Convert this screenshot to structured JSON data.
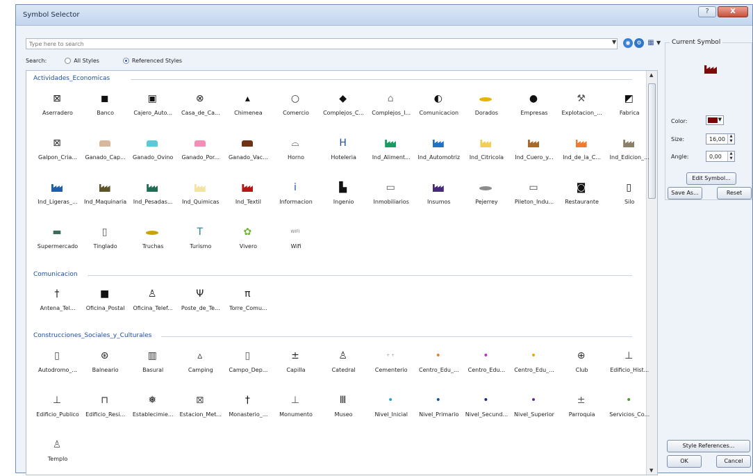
{
  "window": {
    "title": "Symbol Selector",
    "help_label": "?",
    "close_label": "X"
  },
  "search": {
    "placeholder": "Type here to search",
    "label": "Search:",
    "scopes": [
      {
        "label": "All Styles",
        "selected": false
      },
      {
        "label": "Referenced Styles",
        "selected": true
      }
    ]
  },
  "categories": [
    {
      "name": "Actividades_Economicas",
      "symbols": [
        {
          "label": "Aserradero",
          "icon": "sawmill-icon",
          "glyph": "⊠",
          "color": "#222222"
        },
        {
          "label": "Banco",
          "icon": "bank-icon",
          "glyph": "◼",
          "color": "#111111"
        },
        {
          "label": "Cajero_Auto...",
          "icon": "atm-icon",
          "glyph": "▣",
          "color": "#111111"
        },
        {
          "label": "Casa_de_Ca...",
          "icon": "exchange-icon",
          "glyph": "⊗",
          "color": "#222222"
        },
        {
          "label": "Chimenea",
          "icon": "chimney-icon",
          "glyph": "▴",
          "color": "#111111"
        },
        {
          "label": "Comercio",
          "icon": "commerce-icon",
          "glyph": "○",
          "color": "#333333"
        },
        {
          "label": "Complejos_C...",
          "icon": "complex-icon",
          "glyph": "◆",
          "color": "#111111"
        },
        {
          "label": "Complejos_I...",
          "icon": "industrial-complex-icon",
          "glyph": "⌂",
          "color": "#888888"
        },
        {
          "label": "Comunicacion",
          "icon": "communication-icon",
          "glyph": "◐",
          "color": "#111111"
        },
        {
          "label": "Dorados",
          "icon": "fish-icon",
          "glyph": "fish",
          "color": "#e7b400"
        },
        {
          "label": "Empresas",
          "icon": "company-icon",
          "glyph": "●",
          "color": "#111111"
        },
        {
          "label": "Explotacion_...",
          "icon": "mining-icon",
          "glyph": "⚒",
          "color": "#555555"
        },
        {
          "label": "Fabrica",
          "icon": "factory-icon",
          "glyph": "◩",
          "color": "#111111"
        },
        {
          "label": "Galpon_Cria...",
          "icon": "barn-icon",
          "glyph": "⊠",
          "color": "#333333"
        },
        {
          "label": "Ganado_Cap...",
          "icon": "goat-icon",
          "glyph": "animal",
          "color": "#d7b89d"
        },
        {
          "label": "Ganado_Ovino",
          "icon": "sheep-icon",
          "glyph": "animal",
          "color": "#5cc9d9"
        },
        {
          "label": "Ganado_Por...",
          "icon": "pig-icon",
          "glyph": "animal",
          "color": "#f18fb7"
        },
        {
          "label": "Ganado_Vac...",
          "icon": "cow-icon",
          "glyph": "animal",
          "color": "#6c3317"
        },
        {
          "label": "Horno",
          "icon": "oven-icon",
          "glyph": "⌓",
          "color": "#222222"
        },
        {
          "label": "Hoteleria",
          "icon": "hotel-icon",
          "glyph": "H",
          "color": "#1b4f96"
        },
        {
          "label": "Ind_Aliment...",
          "icon": "factory-icon",
          "glyph": "factory",
          "color": "#1a9b63"
        },
        {
          "label": "Ind_Automotriz",
          "icon": "factory-icon",
          "glyph": "factory",
          "color": "#1f73c7"
        },
        {
          "label": "Ind_Citricola",
          "icon": "factory-icon",
          "glyph": "factory",
          "color": "#f1cf52"
        },
        {
          "label": "Ind_Cuero_y...",
          "icon": "factory-icon",
          "glyph": "factory",
          "color": "#a86a2b"
        },
        {
          "label": "Ind_de_la_C...",
          "icon": "factory-icon",
          "glyph": "factory",
          "color": "#f07b2c"
        },
        {
          "label": "Ind_Edicion_...",
          "icon": "factory-icon",
          "glyph": "factory",
          "color": "#8d8068"
        },
        {
          "label": "Ind_Ligeras_...",
          "icon": "factory-icon",
          "glyph": "factory",
          "color": "#1f5ea8"
        },
        {
          "label": "Ind_Maquinaria",
          "icon": "factory-icon",
          "glyph": "factory",
          "color": "#5f5426"
        },
        {
          "label": "Ind_Pesadas...",
          "icon": "factory-icon",
          "glyph": "factory",
          "color": "#206c55"
        },
        {
          "label": "Ind_Quimicas",
          "icon": "factory-icon",
          "glyph": "factory",
          "color": "#f4e4a3"
        },
        {
          "label": "Ind_Textil",
          "icon": "factory-icon",
          "glyph": "factory",
          "color": "#b51717"
        },
        {
          "label": "Informacion",
          "icon": "information-icon",
          "glyph": "i",
          "color": "#1b4f96"
        },
        {
          "label": "Ingenio",
          "icon": "sugar-mill-icon",
          "glyph": "▙",
          "color": "#111111"
        },
        {
          "label": "Inmobiliarios",
          "icon": "real-estate-icon",
          "glyph": "▭",
          "color": "#555555"
        },
        {
          "label": "Insumos",
          "icon": "factory-icon",
          "glyph": "factory",
          "color": "#47287c"
        },
        {
          "label": "Pejerrey",
          "icon": "fish-icon",
          "glyph": "fish",
          "color": "#8b8b8b"
        },
        {
          "label": "Pileton_Indu...",
          "icon": "pool-icon",
          "glyph": "▭",
          "color": "#444444"
        },
        {
          "label": "Restaurante",
          "icon": "restaurant-icon",
          "glyph": "◙",
          "color": "#111111"
        },
        {
          "label": "Silo",
          "icon": "silo-icon",
          "glyph": "▯",
          "color": "#111111"
        },
        {
          "label": "Supermercado",
          "icon": "supermarket-icon",
          "glyph": "▬",
          "color": "#3a6b5c"
        },
        {
          "label": "Tinglado",
          "icon": "shed-icon",
          "glyph": "▯",
          "color": "#555555"
        },
        {
          "label": "Truchas",
          "icon": "fish-icon",
          "glyph": "fish",
          "color": "#c8a400"
        },
        {
          "label": "Turismo",
          "icon": "tourism-icon",
          "glyph": "T",
          "color": "#1e7f9c"
        },
        {
          "label": "Vivero",
          "icon": "nursery-icon",
          "glyph": "✿",
          "color": "#71b53a"
        },
        {
          "label": "Wifi",
          "icon": "wifi-icon",
          "glyph": "WIFI",
          "color": "#777777"
        }
      ]
    },
    {
      "name": "Comunicacion",
      "symbols": [
        {
          "label": "Antena_Tel...",
          "icon": "antenna-icon",
          "glyph": "†",
          "color": "#222222"
        },
        {
          "label": "Oficina_Postal",
          "icon": "post-office-icon",
          "glyph": "■",
          "color": "#111111"
        },
        {
          "label": "Oficina_Telef...",
          "icon": "phone-office-icon",
          "glyph": "♙",
          "color": "#111111"
        },
        {
          "label": "Poste_de_Te...",
          "icon": "telephone-pole-icon",
          "glyph": "Ψ",
          "color": "#222222"
        },
        {
          "label": "Torre_Comu...",
          "icon": "tower-icon",
          "glyph": "π",
          "color": "#222222"
        }
      ]
    },
    {
      "name": "Construcciones_Sociales_y_Culturales",
      "symbols": [
        {
          "label": "Autodromo_...",
          "icon": "racetrack-icon",
          "glyph": "▯",
          "color": "#444444"
        },
        {
          "label": "Balneario",
          "icon": "beach-icon",
          "glyph": "⊛",
          "color": "#222222"
        },
        {
          "label": "Basural",
          "icon": "dump-icon",
          "glyph": "▥",
          "color": "#333333"
        },
        {
          "label": "Camping",
          "icon": "camping-icon",
          "glyph": "▵",
          "color": "#222222"
        },
        {
          "label": "Campo_Dep...",
          "icon": "sports-field-icon",
          "glyph": "▯",
          "color": "#555555"
        },
        {
          "label": "Capilla",
          "icon": "chapel-icon",
          "glyph": "±",
          "color": "#222222"
        },
        {
          "label": "Catedral",
          "icon": "cathedral-icon",
          "glyph": "♙",
          "color": "#222222"
        },
        {
          "label": "Cementerio",
          "icon": "cemetery-icon",
          "glyph": "+ +",
          "color": "#999999"
        },
        {
          "label": "Centro_Edu_...",
          "icon": "education-icon",
          "glyph": "•",
          "color": "#f07b2c"
        },
        {
          "label": "Centro_Edu...",
          "icon": "education-icon",
          "glyph": "•",
          "color": "#c22bd0"
        },
        {
          "label": "Centro_Edu_...",
          "icon": "education-icon",
          "glyph": "•",
          "color": "#e1b100"
        },
        {
          "label": "Club",
          "icon": "club-icon",
          "glyph": "⊕",
          "color": "#333333"
        },
        {
          "label": "Edificio_Hist...",
          "icon": "historic-building-icon",
          "glyph": "⊥",
          "color": "#333333"
        },
        {
          "label": "Edificio_Publico",
          "icon": "public-building-icon",
          "glyph": "⊥",
          "color": "#333333"
        },
        {
          "label": "Edificio_Resi...",
          "icon": "residential-building-icon",
          "glyph": "⊓",
          "color": "#333333"
        },
        {
          "label": "Establecimie...",
          "icon": "establishment-icon",
          "glyph": "❅",
          "color": "#222222"
        },
        {
          "label": "Estacion_Met...",
          "icon": "weather-station-icon",
          "glyph": "⊠",
          "color": "#555555"
        },
        {
          "label": "Monasterio_...",
          "icon": "monastery-icon",
          "glyph": "†",
          "color": "#111111"
        },
        {
          "label": "Monumento",
          "icon": "monument-icon",
          "glyph": "⊥",
          "color": "#555555"
        },
        {
          "label": "Museo",
          "icon": "museum-icon",
          "glyph": "Ⅲ",
          "color": "#222222"
        },
        {
          "label": "Nivel_Inicial",
          "icon": "school-icon",
          "glyph": "•",
          "color": "#28a6d8"
        },
        {
          "label": "Nivel_Primario",
          "icon": "school-icon",
          "glyph": "•",
          "color": "#1b4f96"
        },
        {
          "label": "Nivel_Secund...",
          "icon": "school-icon",
          "glyph": "•",
          "color": "#1f2a7b"
        },
        {
          "label": "Nivel_Superior",
          "icon": "school-icon",
          "glyph": "•",
          "color": "#6b2b8c"
        },
        {
          "label": "Parroquia",
          "icon": "parish-icon",
          "glyph": "±",
          "color": "#555555"
        },
        {
          "label": "Servicios_Co...",
          "icon": "community-services-icon",
          "glyph": "•",
          "color": "#4f9c2d"
        },
        {
          "label": "Templo",
          "icon": "temple-icon",
          "glyph": "♙",
          "color": "#555555"
        }
      ]
    }
  ],
  "current_symbol": {
    "title": "Current Symbol",
    "color_label": "Color:",
    "color": "#7b0607",
    "size_label": "Size:",
    "size_value": "16,00",
    "angle_label": "Angle:",
    "angle_value": "0,00",
    "edit_symbol_label": "Edit Symbol...",
    "save_as_label": "Save As...",
    "reset_label": "Reset"
  },
  "footer": {
    "style_references_label": "Style References...",
    "ok_label": "OK",
    "cancel_label": "Cancel"
  }
}
